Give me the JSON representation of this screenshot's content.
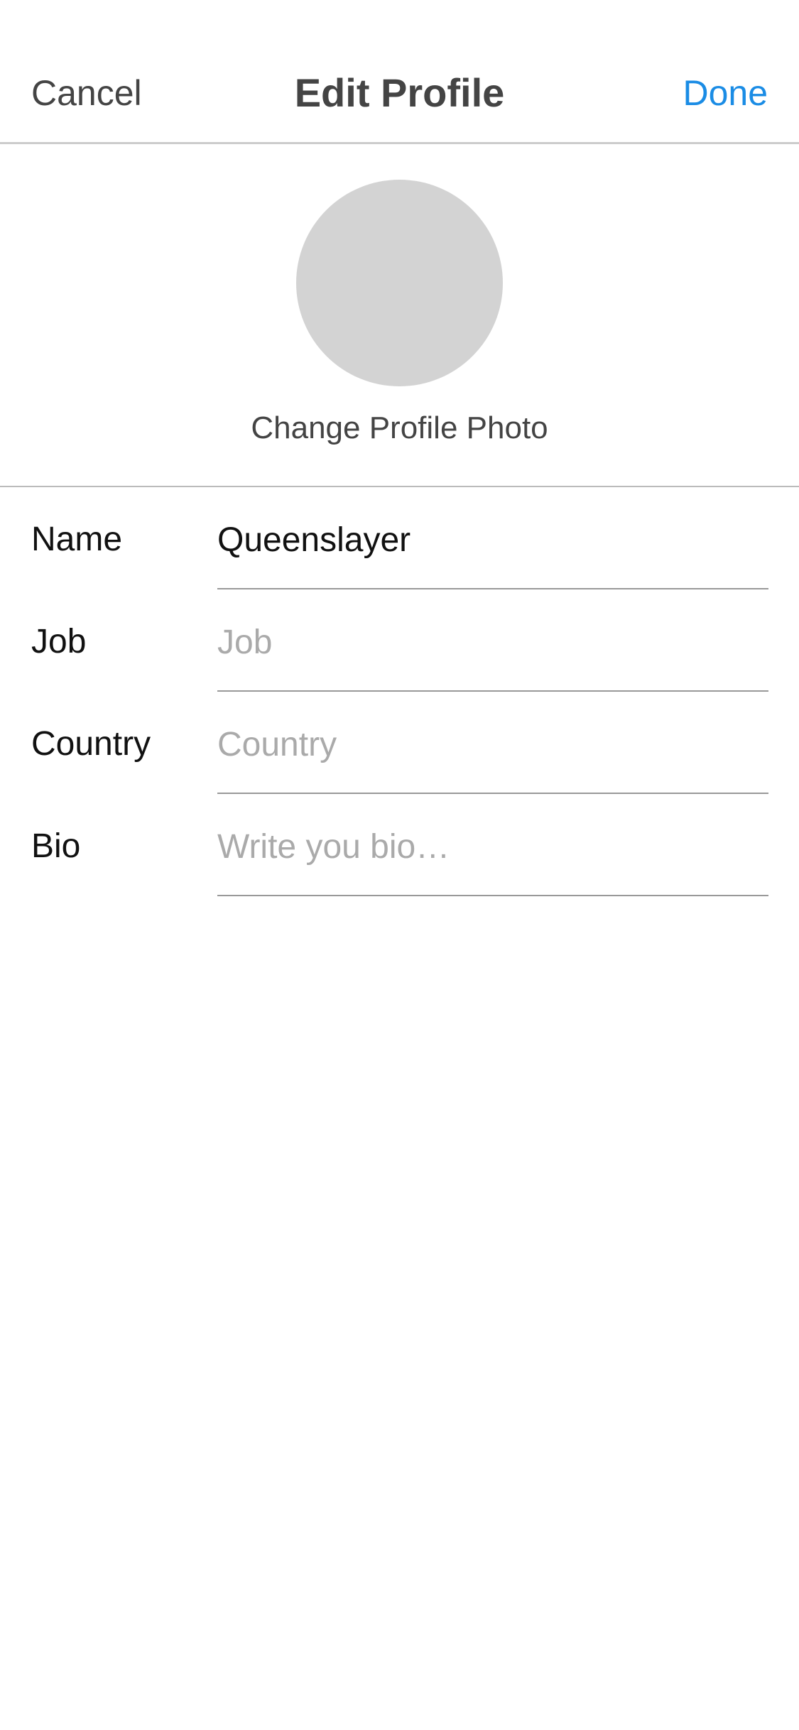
{
  "nav": {
    "cancel_label": "Cancel",
    "title": "Edit Profile",
    "done_label": "Done",
    "done_color": "#1a8ce5"
  },
  "profile_photo": {
    "change_label": "Change Profile Photo",
    "placeholder_color": "#d3d3d3"
  },
  "form": {
    "name": {
      "label": "Name",
      "value": "Queenslayer",
      "placeholder": ""
    },
    "job": {
      "label": "Job",
      "value": "",
      "placeholder": "Job"
    },
    "country": {
      "label": "Country",
      "value": "",
      "placeholder": "Country"
    },
    "bio": {
      "label": "Bio",
      "value": "",
      "placeholder": "Write you bio…"
    }
  }
}
